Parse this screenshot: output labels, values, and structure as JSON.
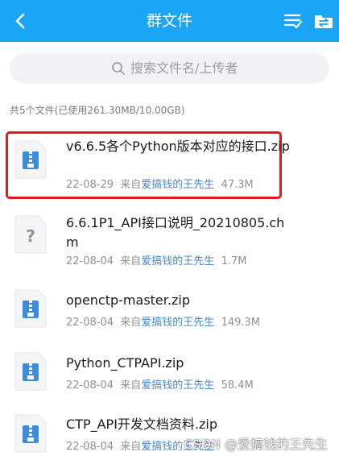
{
  "header": {
    "title": "群文件",
    "back_icon": "back-arrow-icon",
    "list_icon": "list-check-icon",
    "folder_icon": "folder-transfer-icon",
    "color": "#1aa6f5"
  },
  "search": {
    "placeholder": "搜索文件名/上传者"
  },
  "summary": "共5个文件(已使用261.30MB/10.00GB)",
  "files": [
    {
      "name": "v6.6.5各个Python版本对应的接口.zip",
      "date": "22-08-29",
      "from_label": "来自",
      "uploader": "爱搞钱的王先生",
      "size": "47.3M",
      "icon": "zip-file-icon",
      "highlighted": true
    },
    {
      "name": "6.6.1P1_API接口说明_20210805.chm",
      "date": "22-08-04",
      "from_label": "来自",
      "uploader": "爱搞钱的王先生",
      "size": "1.7M",
      "icon": "unknown-file-icon"
    },
    {
      "name": "openctp-master.zip",
      "date": "22-08-04",
      "from_label": "来自",
      "uploader": "爱搞钱的王先生",
      "size": "149.3M",
      "icon": "zip-file-icon"
    },
    {
      "name": "Python_CTPAPI.zip",
      "date": "22-08-04",
      "from_label": "来自",
      "uploader": "爱搞钱的王先生",
      "size": "58.4M",
      "icon": "zip-file-icon"
    },
    {
      "name": "CTP_API开发文档资料.zip",
      "date": "22-08-04",
      "from_label": "来自",
      "uploader": "爱搞钱的王先生",
      "size": "",
      "icon": "zip-file-icon"
    }
  ],
  "watermark": "CSDN @爱搞钱的王先生"
}
